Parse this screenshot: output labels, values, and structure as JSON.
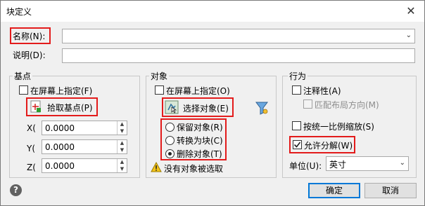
{
  "window": {
    "title": "块定义",
    "close_glyph": "✕"
  },
  "name_field": {
    "label": "名称(N):",
    "value": ""
  },
  "description_field": {
    "label": "说明(D):",
    "value": ""
  },
  "base_point": {
    "group_label": "基点",
    "specify_on_screen": "在屏幕上指定(F)",
    "pick_button": "拾取基点(P)",
    "x_label": "X(",
    "x_value": "0.0000",
    "y_label": "Y(",
    "y_value": "0.0000",
    "z_label": "Z(",
    "z_value": "0.0000"
  },
  "objects": {
    "group_label": "对象",
    "specify_on_screen": "在屏幕上指定(O)",
    "select_button": "选择对象(E)",
    "retain": "保留对象(R)",
    "convert": "转换为块(C)",
    "delete": "删除对象(T)",
    "warning": "没有对象被选取",
    "selected_option": "delete"
  },
  "behavior": {
    "group_label": "行为",
    "annotative": "注释性(A)",
    "match_orientation": "匹配布局方向(M)",
    "scale_uniformly": "按统一比例缩放(S)",
    "allow_explode": "允许分解(W)",
    "allow_explode_checked": true,
    "units_label": "单位(U):",
    "units_value": "英寸"
  },
  "buttons": {
    "ok": "确定",
    "cancel": "取消",
    "help": "?"
  },
  "colors": {
    "highlight": "#e31b1b",
    "accent": "#0078d7",
    "help_icon": "#616161"
  }
}
